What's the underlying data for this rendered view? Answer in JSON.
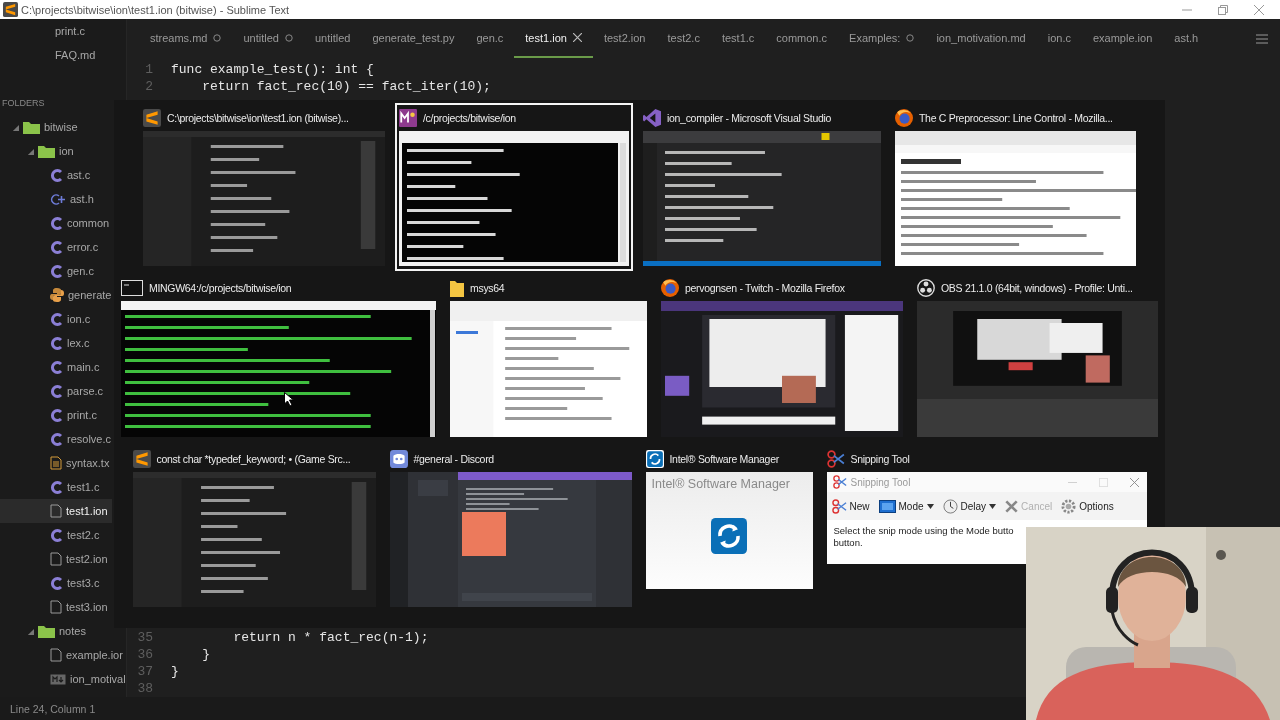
{
  "window": {
    "title": "C:\\projects\\bitwise\\ion\\test1.ion (bitwise) - Sublime Text"
  },
  "sidebar": {
    "open_files": [
      "print.c",
      "FAQ.md"
    ],
    "folders_heading": "FOLDERS",
    "tree": [
      {
        "name": "bitwise",
        "kind": "folder",
        "expanded": true,
        "children": [
          {
            "name": "ion",
            "kind": "folder",
            "expanded": true,
            "children": [
              {
                "name": "ast.c",
                "kind": "c",
                "selected": false
              },
              {
                "name": "ast.h",
                "kind": "h",
                "selected": false
              },
              {
                "name": "common",
                "kind": "c",
                "selected": false
              },
              {
                "name": "error.c",
                "kind": "c",
                "selected": false
              },
              {
                "name": "gen.c",
                "kind": "c",
                "selected": false
              },
              {
                "name": "generate",
                "kind": "py",
                "selected": false
              },
              {
                "name": "ion.c",
                "kind": "c",
                "selected": false
              },
              {
                "name": "lex.c",
                "kind": "c",
                "selected": false
              },
              {
                "name": "main.c",
                "kind": "c",
                "selected": false
              },
              {
                "name": "parse.c",
                "kind": "c",
                "selected": false
              },
              {
                "name": "print.c",
                "kind": "c",
                "selected": false
              },
              {
                "name": "resolve.c",
                "kind": "c",
                "selected": false
              },
              {
                "name": "syntax.tx",
                "kind": "txt",
                "selected": false
              },
              {
                "name": "test1.c",
                "kind": "c",
                "selected": false
              },
              {
                "name": "test1.ion",
                "kind": "file",
                "selected": true
              },
              {
                "name": "test2.c",
                "kind": "c",
                "selected": false
              },
              {
                "name": "test2.ion",
                "kind": "file",
                "selected": false
              },
              {
                "name": "test3.c",
                "kind": "c",
                "selected": false
              },
              {
                "name": "test3.ion",
                "kind": "file",
                "selected": false
              }
            ]
          },
          {
            "name": "notes",
            "kind": "folder",
            "expanded": true,
            "children": [
              {
                "name": "example.ior",
                "kind": "file",
                "selected": false
              },
              {
                "name": "ion_motival",
                "kind": "md",
                "selected": false
              }
            ]
          }
        ]
      }
    ]
  },
  "tabs": [
    {
      "label": "streams.md",
      "selected": false,
      "dirty": true
    },
    {
      "label": "untitled",
      "selected": false,
      "dirty": true
    },
    {
      "label": "untitled",
      "selected": false,
      "dirty": false
    },
    {
      "label": "generate_test.py",
      "selected": false,
      "dirty": false
    },
    {
      "label": "gen.c",
      "selected": false,
      "dirty": false
    },
    {
      "label": "test1.ion",
      "selected": true,
      "dirty": false
    },
    {
      "label": "test2.ion",
      "selected": false,
      "dirty": false
    },
    {
      "label": "test2.c",
      "selected": false,
      "dirty": false
    },
    {
      "label": "test1.c",
      "selected": false,
      "dirty": false
    },
    {
      "label": "common.c",
      "selected": false,
      "dirty": false
    },
    {
      "label": "Examples:",
      "selected": false,
      "dirty": true
    },
    {
      "label": "ion_motivation.md",
      "selected": false,
      "dirty": false
    },
    {
      "label": "ion.c",
      "selected": false,
      "dirty": false
    },
    {
      "label": "example.ion",
      "selected": false,
      "dirty": false
    },
    {
      "label": "ast.h",
      "selected": false,
      "dirty": false
    }
  ],
  "editor": {
    "lines_top": [
      {
        "number": "1",
        "text": "func example_test(): int {"
      },
      {
        "number": "2",
        "text": "    return fact_rec(10) == fact_iter(10);"
      }
    ],
    "lines_bottom": [
      {
        "number": "35",
        "text": "        return n * fact_rec(n-1);"
      },
      {
        "number": "36",
        "text": "    }"
      },
      {
        "number": "37",
        "text": "}"
      },
      {
        "number": "38"
      }
    ]
  },
  "window_switcher": {
    "windows": [
      {
        "title": "C:\\projects\\bitwise\\ion\\test1.ion (bitwise)...",
        "kind": "sublime",
        "selected": false,
        "thumbnail": {
          "kind": "editor"
        }
      },
      {
        "title": "/c/projects/bitwise/ion",
        "kind": "msys",
        "selected": true,
        "thumbnail": {
          "kind": "console"
        }
      },
      {
        "title": "ion_compiler - Microsoft Visual Studio",
        "kind": "vs",
        "selected": false,
        "thumbnail": {
          "kind": "ide"
        }
      },
      {
        "title": "The C Preprocessor: Line Control - Mozilla...",
        "kind": "firefox",
        "selected": false,
        "thumbnail": {
          "kind": "webpage"
        }
      },
      {
        "title": "MINGW64:/c/projects/bitwise/ion",
        "kind": "mintty",
        "selected": false,
        "thumbnail": {
          "kind": "terminal"
        }
      },
      {
        "title": "msys64",
        "kind": "explorer",
        "selected": false,
        "thumbnail": {
          "kind": "explorer"
        }
      },
      {
        "title": "pervognsen - Twitch - Mozilla Firefox",
        "kind": "firefox",
        "selected": false,
        "thumbnail": {
          "kind": "stream"
        }
      },
      {
        "title": "OBS 21.1.0 (64bit, windows) - Profile: Unti...",
        "kind": "obs",
        "selected": false,
        "thumbnail": {
          "kind": "obs"
        }
      },
      {
        "title": "const char *typedef_keyword; • (Game Src...",
        "kind": "sublime",
        "selected": false,
        "thumbnail": {
          "kind": "editor"
        }
      },
      {
        "title": "#general - Discord",
        "kind": "discord",
        "selected": false,
        "thumbnail": {
          "kind": "chat"
        }
      },
      {
        "title": "Intel® Software Manager",
        "kind": "intel",
        "selected": false,
        "thumbnail": {
          "kind": "app",
          "title": "Intel® Software Manager"
        }
      },
      {
        "title": "Snipping Tool",
        "kind": "snipping",
        "selected": false,
        "thumbnail": {
          "kind": "snipping",
          "title": "Snipping Tool",
          "buttons": [
            {
              "label": "New",
              "kind": "new",
              "dropdown": false,
              "disabled": false
            },
            {
              "label": "Mode",
              "kind": "mode",
              "dropdown": true,
              "disabled": false
            },
            {
              "label": "Delay",
              "kind": "delay",
              "dropdown": true,
              "disabled": false
            },
            {
              "label": "Cancel",
              "kind": "cancel",
              "dropdown": false,
              "disabled": true
            },
            {
              "label": "Options",
              "kind": "options",
              "dropdown": false,
              "disabled": false
            }
          ],
          "message_lines": [
            "Select the snip mode using the Mode butto",
            "button."
          ]
        }
      }
    ]
  },
  "status_bar": {
    "text": "Line 24, Column 1"
  }
}
